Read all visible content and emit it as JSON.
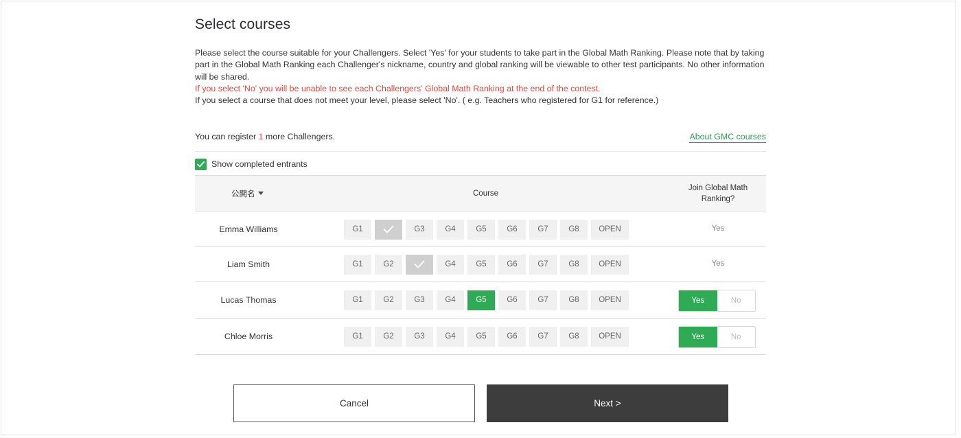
{
  "page": {
    "title": "Select courses",
    "description": [
      "Please select the course suitable for your Challengers. Select 'Yes' for your students to take part in the Global Math Ranking. Please note that by taking part in the Global Math Ranking each Challenger's nickname, country and global ranking will be viewable to other test participants. No other information will be shared.",
      "If you select 'No' you will be unable to see each Challengers' Global Math Ranking at the end of the contest.",
      "If you select a course that does not meet your level, please select 'No'. ( e.g. Teachers who registered for G1 for reference.)"
    ]
  },
  "register": {
    "prefix": "You can register ",
    "count": "1",
    "suffix": " more Challengers."
  },
  "about_link": "About GMC courses",
  "show_completed": {
    "label": "Show completed entrants",
    "checked": true
  },
  "table": {
    "headers": {
      "name": "公開名",
      "course": "Course",
      "join": "Join Global Math Ranking?"
    },
    "course_options": [
      "G1",
      "G2",
      "G3",
      "G4",
      "G5",
      "G6",
      "G7",
      "G8",
      "OPEN"
    ],
    "rows": [
      {
        "name": "Emma Williams",
        "completed_course": "G2",
        "selected_course": null,
        "join": "Yes",
        "join_editable": false
      },
      {
        "name": "Liam Smith",
        "completed_course": "G3",
        "selected_course": null,
        "join": "Yes",
        "join_editable": false
      },
      {
        "name": "Lucas Thomas",
        "completed_course": null,
        "selected_course": "G5",
        "join": "Yes",
        "join_editable": true
      },
      {
        "name": "Chloe Morris",
        "completed_course": null,
        "selected_course": null,
        "join": "Yes",
        "join_editable": true
      }
    ],
    "toggle": {
      "yes_label": "Yes",
      "no_label": "No"
    }
  },
  "buttons": {
    "cancel": "Cancel",
    "next": "Next >"
  },
  "colors": {
    "accent_green": "#2faa55",
    "warning_red": "#e8483a",
    "completed_grey": "#cfcfcf",
    "next_button": "#3d3d3d"
  }
}
